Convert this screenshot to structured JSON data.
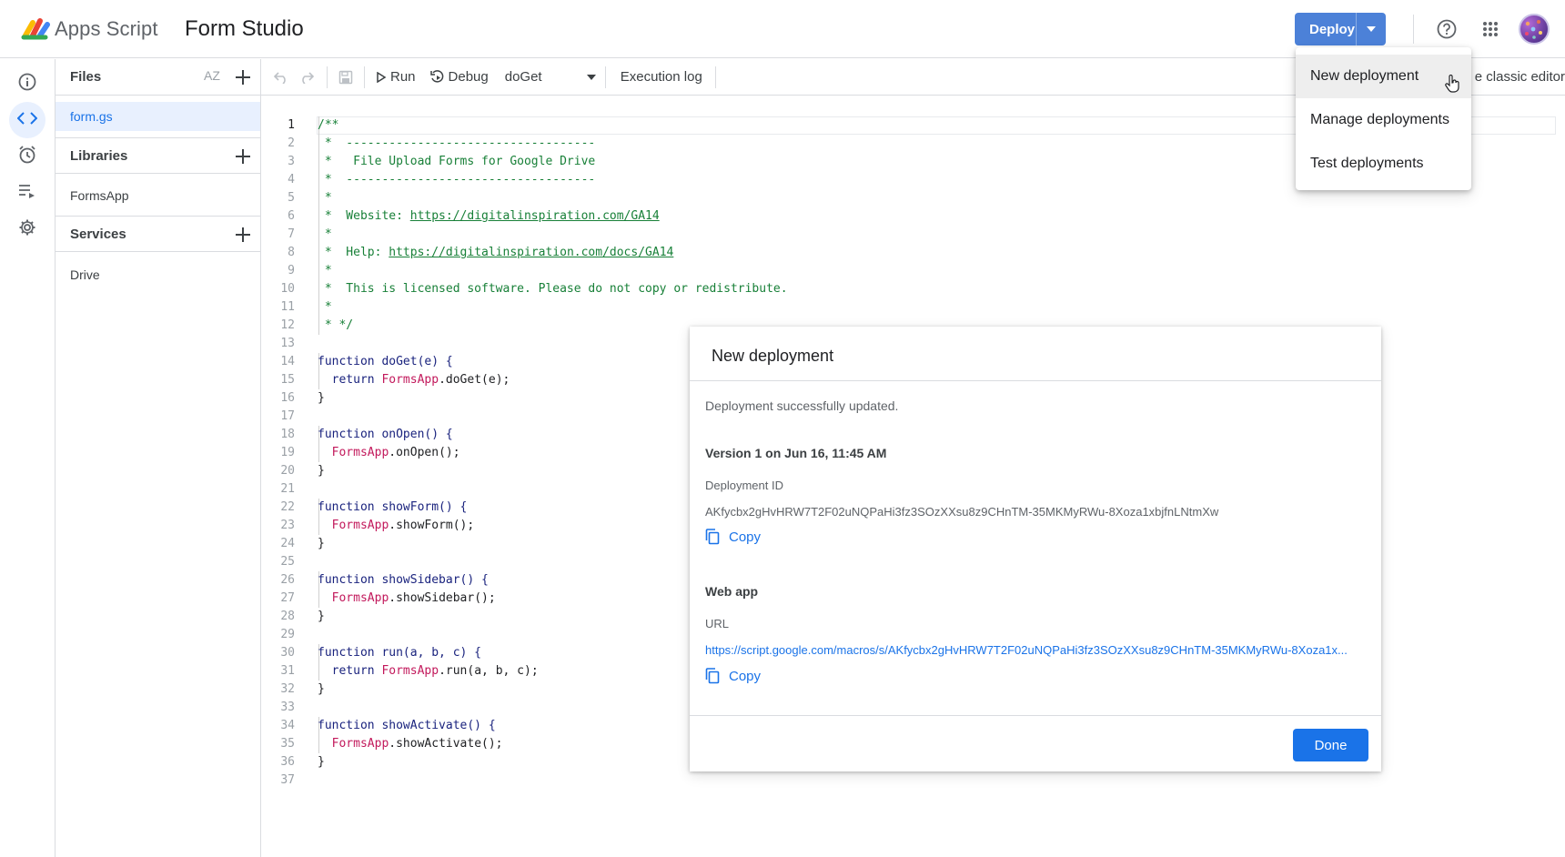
{
  "header": {
    "app_name": "Apps Script",
    "project_name": "Form Studio",
    "deploy_label": "Deploy",
    "icons": [
      "help-icon",
      "apps-grid-icon",
      "avatar"
    ]
  },
  "rail": {
    "items": [
      "info-icon",
      "code-icon",
      "clock-icon",
      "executions-icon",
      "gear-icon"
    ],
    "active": "code-icon"
  },
  "files_panel": {
    "files_title": "Files",
    "sort_label": "AZ",
    "files": [
      "form.gs"
    ],
    "libraries_title": "Libraries",
    "libraries": [
      "FormsApp"
    ],
    "services_title": "Services",
    "services": [
      "Drive"
    ]
  },
  "toolbar": {
    "run_label": "Run",
    "debug_label": "Debug",
    "function_select": "doGet",
    "execution_log_label": "Execution log",
    "classic_editor_label": "e classic editor"
  },
  "editor": {
    "line_numbers": [
      "1",
      "2",
      "3",
      "4",
      "5",
      "6",
      "7",
      "8",
      "9",
      "10",
      "11",
      "12",
      "13",
      "14",
      "15",
      "16",
      "17",
      "18",
      "19",
      "20",
      "21",
      "22",
      "23",
      "24",
      "25",
      "26",
      "27",
      "28",
      "29",
      "30",
      "31",
      "32",
      "33",
      "34",
      "35",
      "36",
      "37"
    ],
    "comment": {
      "l1": "/**",
      "l2": " *  -----------------------------------",
      "l3": " *   File Upload Forms for Google Drive",
      "l4": " *  -----------------------------------",
      "l5": " *",
      "l6_prefix": " *  Website: ",
      "l6_link": "https://digitalinspiration.com/GA14",
      "l7": " *",
      "l8_prefix": " *  Help: ",
      "l8_link": "https://digitalinspiration.com/docs/GA14",
      "l9": " *",
      "l10": " *  This is licensed software. Please do not copy or redistribute.",
      "l11": " *",
      "l12": " * */"
    },
    "code": {
      "l14": "function doGet(e) {",
      "l15_kw": "  return ",
      "l15_obj": "FormsApp",
      "l15_rest": ".doGet(e);",
      "l16": "}",
      "l18": "function onOpen() {",
      "l19_obj": "  FormsApp",
      "l19_rest": ".onOpen();",
      "l20": "}",
      "l22": "function showForm() {",
      "l23_obj": "  FormsApp",
      "l23_rest": ".showForm();",
      "l24": "}",
      "l26": "function showSidebar() {",
      "l27_obj": "  FormsApp",
      "l27_rest": ".showSidebar();",
      "l28": "}",
      "l30": "function run(a, b, c) {",
      "l31_kw": "  return ",
      "l31_obj": "FormsApp",
      "l31_rest": ".run(a, b, c);",
      "l32": "}",
      "l34": "function showActivate() {",
      "l35_obj": "  FormsApp",
      "l35_rest": ".showActivate();",
      "l36": "}"
    }
  },
  "deploy_menu": {
    "items": [
      "New deployment",
      "Manage deployments",
      "Test deployments"
    ],
    "hovered": "New deployment"
  },
  "dialog": {
    "title": "New deployment",
    "status": "Deployment successfully updated.",
    "version": "Version 1 on Jun 16, 11:45 AM",
    "deployment_id_label": "Deployment ID",
    "deployment_id": "AKfycbx2gHvHRW7T2F02uNQPaHi3fz3SOzXXsu8z9CHnTM-35MKMyRWu-8Xoza1xbjfnLNtmXw",
    "copy_label": "Copy",
    "web_app_label": "Web app",
    "url_label": "URL",
    "url": "https://script.google.com/macros/s/AKfycbx2gHvHRW7T2F02uNQPaHi3fz3SOzXXsu8z9CHnTM-35MKMyRWu-8Xoza1x...",
    "done_label": "Done"
  },
  "colors": {
    "deploy_button": "#4c81d8",
    "primary_blue": "#1a73e8",
    "comment_green": "#188038",
    "keyword_navy": "#1a237e",
    "object_pink": "#c2185b"
  }
}
